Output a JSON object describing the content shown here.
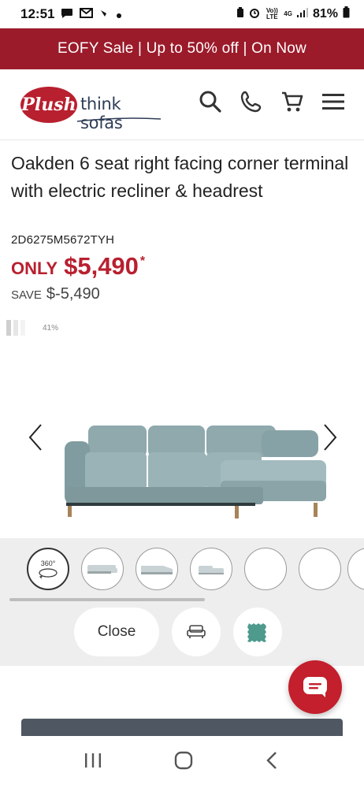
{
  "status_bar": {
    "time": "12:51",
    "icons": [
      "chat-bubble-icon",
      "gmail-icon",
      "app-icon",
      "dot-icon"
    ],
    "right_icons": [
      "battery-saver-icon",
      "alarm-icon",
      "volte-icon",
      "4g-icon",
      "signal-icon",
      "battery-icon"
    ],
    "volte_label": "Vo)) LTE",
    "network_label": "4G",
    "battery": "81%"
  },
  "promo": {
    "text": "EOFY Sale | Up to 50% off | On Now"
  },
  "header": {
    "logo_badge": "Plush",
    "logo_text": "think sofas",
    "icons": [
      "search-icon",
      "phone-icon",
      "cart-icon",
      "menu-icon"
    ]
  },
  "product": {
    "title": "Oakden 6 seat right facing corner terminal with electric recliner & headrest",
    "sku": "2D6275M5672TYH",
    "price_label": "ONLY",
    "price": "$5,490",
    "price_note": "*",
    "save_label": "SAVE",
    "save_value": "$-5,490",
    "load_progress": "41%"
  },
  "viewer": {
    "thumbnails": [
      {
        "name": "thumb-360",
        "label": "360°"
      },
      {
        "name": "thumb-sofa-front"
      },
      {
        "name": "thumb-sofa-angle"
      },
      {
        "name": "thumb-sofa-side"
      },
      {
        "name": "thumb-empty-1"
      },
      {
        "name": "thumb-empty-2"
      }
    ],
    "close_label": "Close",
    "colors": {
      "sofa": "#8fa9ad",
      "swatch": "#4e9a8d"
    }
  },
  "colors": {
    "brand_red": "#9b1b2a",
    "price_red": "#b8202f",
    "chat_red": "#c31f2c"
  }
}
